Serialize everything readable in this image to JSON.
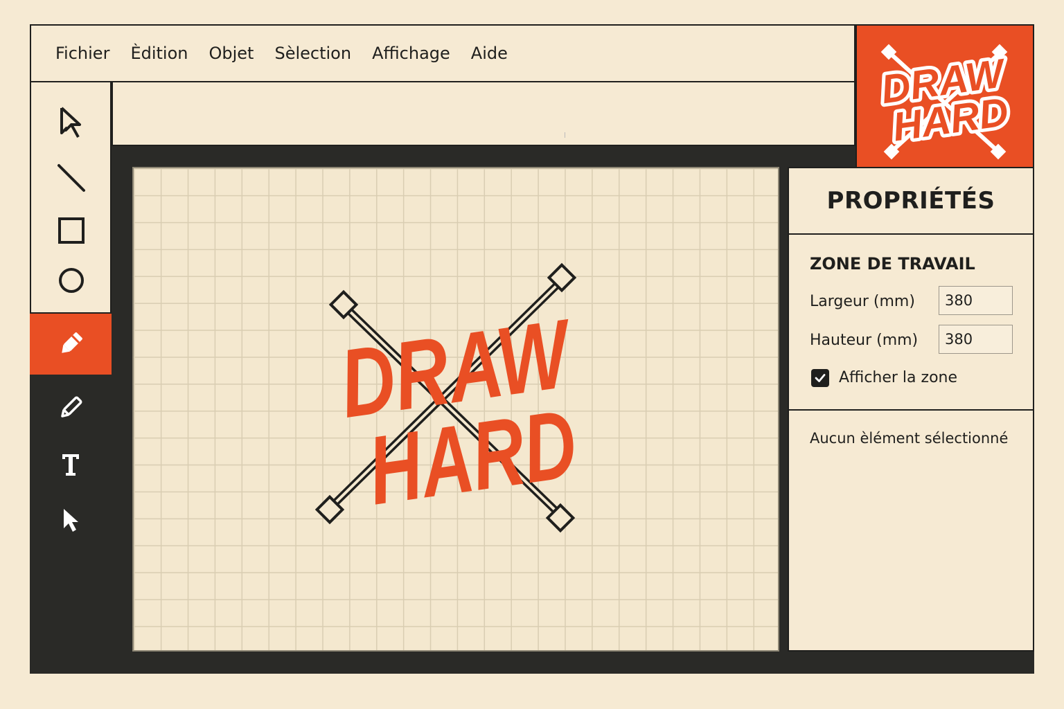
{
  "menubar": {
    "items": [
      "Fichier",
      "Èdition",
      "Objet",
      "Sèlection",
      "Affichage",
      "Aide"
    ]
  },
  "logo": {
    "line1": "DRAW",
    "line2": "HARD"
  },
  "artwork": {
    "line1": "DRAW",
    "line2": "HARD"
  },
  "colors": {
    "accent": "#e94f24",
    "background": "#f6ead3",
    "dark": "#2a2a27"
  },
  "toolbar": {
    "tools": [
      "selection-arrow-icon",
      "line-icon",
      "rectangle-icon",
      "ellipse-icon",
      "pen-icon",
      "pencil-icon",
      "text-icon",
      "direct-select-icon"
    ],
    "active": "pen-icon"
  },
  "properties": {
    "title": "PROPRIÉTÉS",
    "section_title": "ZONE DE TRAVAIL",
    "width_label": "Largeur (mm)",
    "width_value": "380",
    "height_label": "Hauteur (mm)",
    "height_value": "380",
    "show_zone_label": "Afficher la zone",
    "show_zone_checked": true,
    "no_selection": "Aucun èlément sélectionné"
  }
}
